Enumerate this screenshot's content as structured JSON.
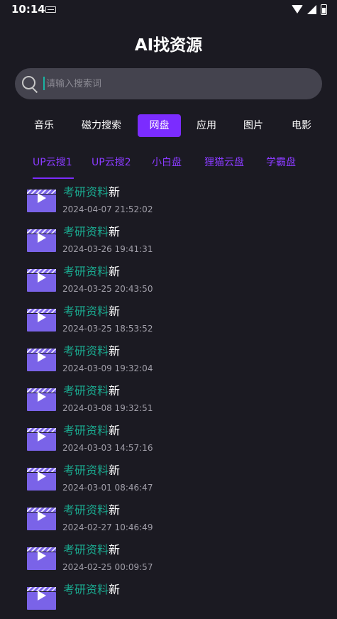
{
  "status_bar": {
    "time": "10:14"
  },
  "app": {
    "title": "AI找资源"
  },
  "search": {
    "placeholder": "请输入搜索词",
    "value": ""
  },
  "categories": [
    {
      "label": "音乐",
      "active": false
    },
    {
      "label": "磁力搜索",
      "active": false
    },
    {
      "label": "网盘",
      "active": true
    },
    {
      "label": "应用",
      "active": false
    },
    {
      "label": "图片",
      "active": false
    },
    {
      "label": "电影",
      "active": false
    }
  ],
  "sources": [
    {
      "label": "UP云搜1",
      "active": true
    },
    {
      "label": "UP云搜2",
      "active": false
    },
    {
      "label": "小白盘",
      "active": false
    },
    {
      "label": "狸猫云盘",
      "active": false
    },
    {
      "label": "学霸盘",
      "active": false
    }
  ],
  "results": [
    {
      "title": "考研资料",
      "badge": "新",
      "date": "2024-04-07 21:52:02"
    },
    {
      "title": "考研资料",
      "badge": "新",
      "date": "2024-03-26 19:41:31"
    },
    {
      "title": "考研资料",
      "badge": "新",
      "date": "2024-03-25 20:43:50"
    },
    {
      "title": "考研资料",
      "badge": "新",
      "date": "2024-03-25 18:53:52"
    },
    {
      "title": "考研资料",
      "badge": "新",
      "date": "2024-03-09 19:32:04"
    },
    {
      "title": "考研资料",
      "badge": "新",
      "date": "2024-03-08 19:32:51"
    },
    {
      "title": "考研资料",
      "badge": "新",
      "date": "2024-03-03 14:57:16"
    },
    {
      "title": "考研资料",
      "badge": "新",
      "date": "2024-03-01 08:46:47"
    },
    {
      "title": "考研资料",
      "badge": "新",
      "date": "2024-02-27 10:46:49"
    },
    {
      "title": "考研资料",
      "badge": "新",
      "date": "2024-02-25 00:09:57"
    },
    {
      "title": "考研资料",
      "badge": "新",
      "date": ""
    }
  ],
  "colors": {
    "background": "#1b1a22",
    "accent": "#7b2cff",
    "title_green": "#1aa88e",
    "search_bg": "#44434e"
  }
}
